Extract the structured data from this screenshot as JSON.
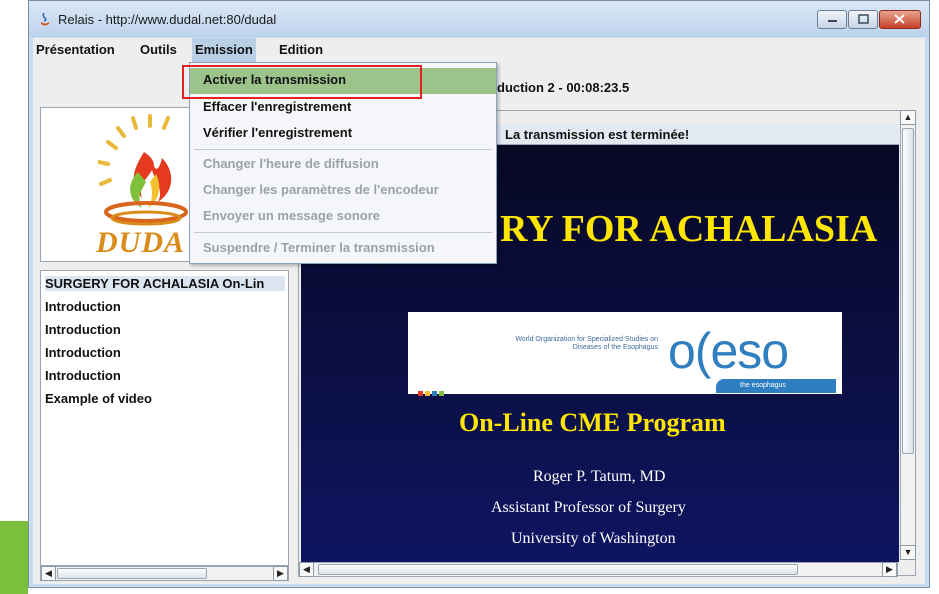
{
  "window": {
    "title": "Relais - http://www.dudal.net:80/dudal",
    "controls": [
      "minimize",
      "maximize",
      "close"
    ]
  },
  "menubar": {
    "items": [
      {
        "label": "Présentation"
      },
      {
        "label": "Outils"
      },
      {
        "label": "Emission",
        "open": true
      },
      {
        "label": "Edition"
      }
    ]
  },
  "emission_menu": {
    "items": [
      {
        "label": "Activer la transmission",
        "enabled": true,
        "highlighted": true
      },
      {
        "label": "Effacer l'enregistrement",
        "enabled": true
      },
      {
        "label": "Vérifier l'enregistrement",
        "enabled": true
      },
      {
        "label": "Changer l'heure de diffusion",
        "enabled": false
      },
      {
        "label": "Changer les paramètres de l'encodeur",
        "enabled": false
      },
      {
        "label": "Envoyer un message sonore",
        "enabled": false
      },
      {
        "label": "Suspendre / Terminer la transmission",
        "enabled": false
      }
    ]
  },
  "logo": {
    "text": "DUDA",
    "icon": "flame-logo-icon"
  },
  "playlist": {
    "items": [
      "SURGERY FOR ACHALASIA On-Lin",
      "Introduction",
      "Introduction",
      "Introduction",
      "Introduction",
      "Example of video"
    ]
  },
  "status": {
    "header": "duction 2 - 00:08:23.5",
    "banner": "La transmission est terminée!"
  },
  "slide": {
    "title": "RY FOR ACHALASIA",
    "oeso_small": "World Organization for Specialized Studies on Diseases of the Esophagus",
    "oeso_logo": "o(eso",
    "oeso_tagline": "the esophagus",
    "program": "On-Line CME Program",
    "credits": [
      "Roger P. Tatum, MD",
      "Assistant Professor of Surgery",
      "University of Washington"
    ]
  },
  "colors": {
    "highlight_green": "#9cc38a",
    "annotation_red": "#e12222",
    "slide_yellow": "#ffe600",
    "slide_navy": "#0b0e3e",
    "accent_green": "#7cbf3a"
  }
}
